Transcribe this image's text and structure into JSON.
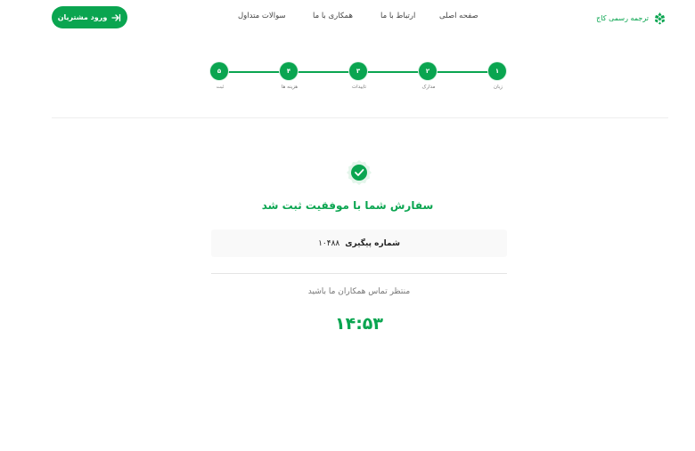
{
  "header": {
    "login_label": "ورود مشتریان",
    "nav": [
      {
        "label": "صفحه اصلی"
      },
      {
        "label": "ارتباط با ما"
      },
      {
        "label": "همکاری با ما"
      },
      {
        "label": "سوالات متداول"
      }
    ],
    "logo_text": "ترجمه رسمی کاج"
  },
  "stepper": {
    "steps": [
      {
        "number": "۱",
        "label": "زبان"
      },
      {
        "number": "۲",
        "label": "مدارک"
      },
      {
        "number": "۳",
        "label": "تاییدات"
      },
      {
        "number": "۴",
        "label": "هزینه ها"
      },
      {
        "number": "۵",
        "label": "ثبت"
      }
    ]
  },
  "result": {
    "title": "سفارش شما با موفقیت ثبت شد",
    "tracking_label": "شماره پیگیری",
    "tracking_number": "۱۰۴۸۸",
    "waiting_text": "منتظر تماس همکاران ما باشید",
    "timer": "۱۴:۵۳"
  },
  "colors": {
    "accent": "#0aa550"
  },
  "icons": {
    "login": "login-arrow-icon",
    "logo": "pinecone-icon",
    "success": "check-badge-icon"
  }
}
